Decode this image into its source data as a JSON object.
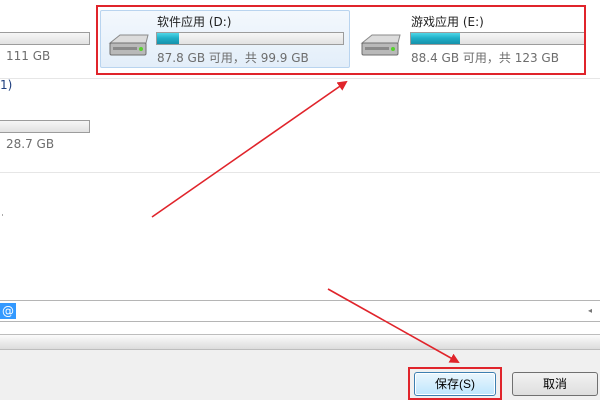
{
  "drives_left_partial": [
    {
      "size_text": "111 GB"
    },
    {
      "size_text": "28.7 GB"
    }
  ],
  "side_label_fragment": "1)",
  "drives": [
    {
      "name": "软件应用 (D:)",
      "size_text": "87.8 GB 可用，共 99.9 GB",
      "used_fraction": 0.12,
      "icon": "hard-drive-icon"
    },
    {
      "name": "游戏应用 (E:)",
      "size_text": "88.4 GB 可用，共 123 GB",
      "used_fraction": 0.28,
      "icon": "hard-drive-icon"
    }
  ],
  "path_field": {
    "value": "@"
  },
  "buttons": {
    "save_label": "保存(S)",
    "cancel_label": "取消"
  },
  "colors": {
    "annotation_red": "#e0242b",
    "drive_fill": "#21b0c8",
    "selection": "#e3eef9"
  }
}
